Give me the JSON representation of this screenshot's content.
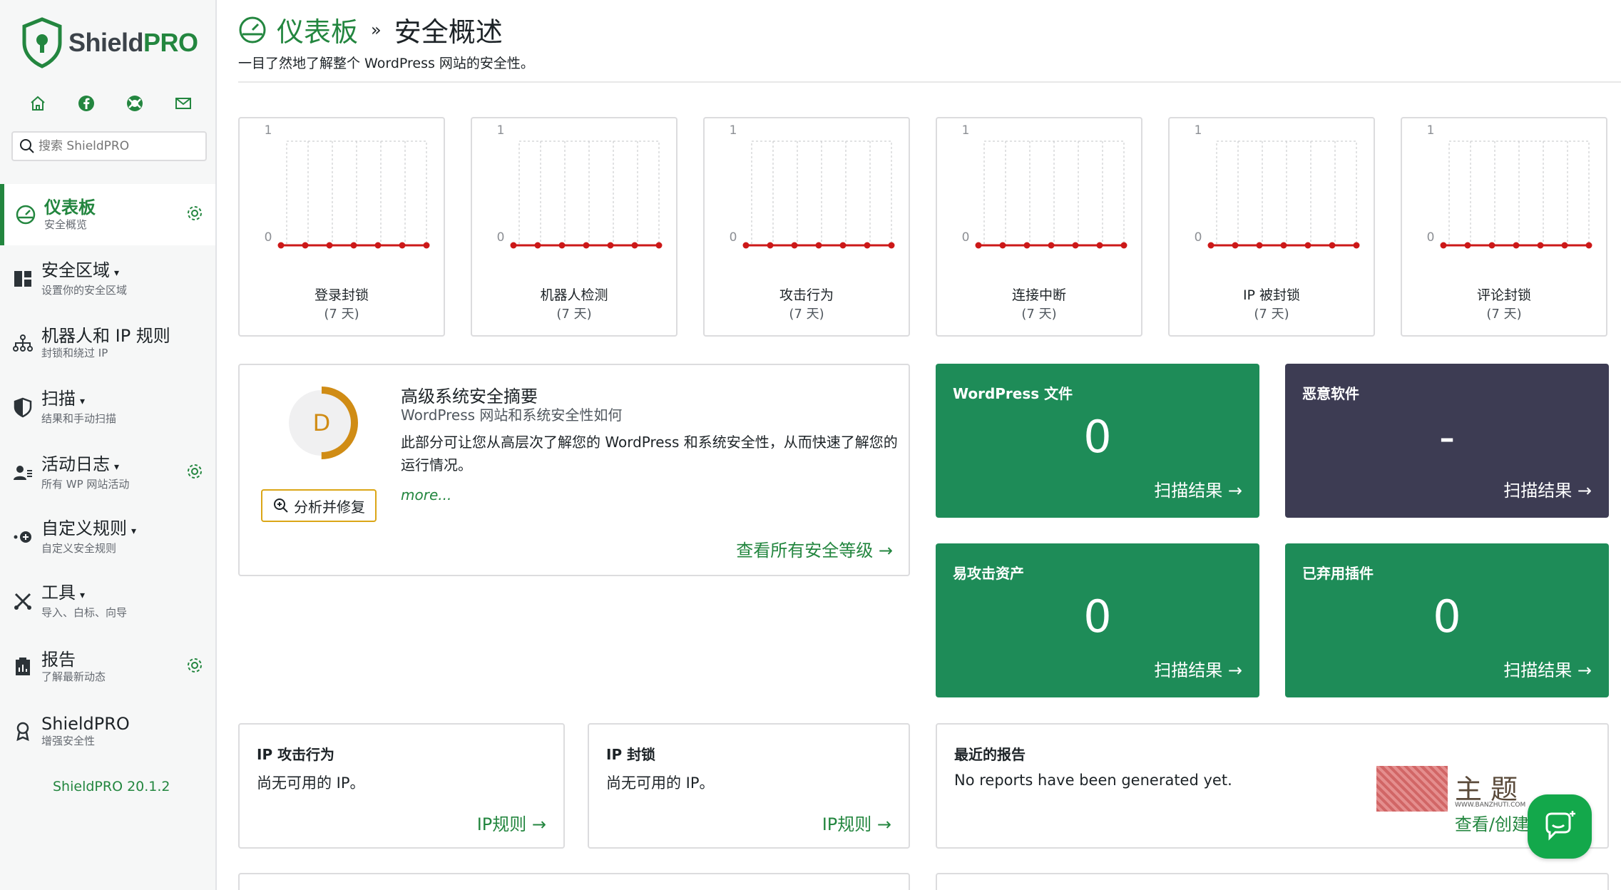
{
  "brand": {
    "name_main": "Shield",
    "name_pro": "PRO"
  },
  "search": {
    "placeholder": "搜索 ShieldPRO"
  },
  "quick_icons": [
    "home-icon",
    "facebook-icon",
    "support-icon",
    "mail-icon"
  ],
  "nav": [
    {
      "title": "仪表板",
      "sub": "安全概览",
      "icon": "dashboard-icon",
      "caret": "",
      "gear": true,
      "active": true
    },
    {
      "title": "安全区域",
      "sub": "设置你的安全区域",
      "icon": "layout-icon",
      "caret": "▾",
      "gear": false
    },
    {
      "title": "机器人和 IP 规则",
      "sub": "封锁和绕过 IP",
      "icon": "network-icon",
      "caret": "",
      "gear": false
    },
    {
      "title": "扫描",
      "sub": "结果和手动扫描",
      "icon": "shield-half-icon",
      "caret": "▾",
      "gear": false
    },
    {
      "title": "活动日志",
      "sub": "所有 WP 网站活动",
      "icon": "users-icon",
      "caret": "▾",
      "gear": true
    },
    {
      "title": "自定义规则",
      "sub": "自定义安全规则",
      "icon": "rules-icon",
      "caret": "▾",
      "gear": false
    },
    {
      "title": "工具",
      "sub": "导入、白标、向导",
      "icon": "tools-icon",
      "caret": "▾",
      "gear": false
    },
    {
      "title": "报告",
      "sub": "了解最新动态",
      "icon": "report-icon",
      "caret": "",
      "gear": true
    },
    {
      "title": "ShieldPRO",
      "sub": "增强安全性",
      "icon": "award-icon",
      "caret": "",
      "gear": false
    }
  ],
  "version": "ShieldPRO 20.1.2",
  "header": {
    "crumb1": "仪表板",
    "sep": "»",
    "crumb2": "安全概述",
    "subtitle": "一目了然地了解整个 WordPress 网站的安全性。"
  },
  "charts": [
    {
      "label": "登录封锁",
      "period": "(7 天)"
    },
    {
      "label": "机器人检测",
      "period": "(7 天)"
    },
    {
      "label": "攻击行为",
      "period": "(7 天)"
    },
    {
      "label": "连接中断",
      "period": "(7 天)"
    },
    {
      "label": "IP 被封锁",
      "period": "(7 天)"
    },
    {
      "label": "评论封锁",
      "period": "(7 天)"
    }
  ],
  "chart_data": {
    "type": "line",
    "note_series": "six sparkline charts, each with 7 daily points all at 0",
    "x": [
      1,
      2,
      3,
      4,
      5,
      6,
      7
    ],
    "ylim": [
      0,
      1
    ],
    "y_ticks": [
      "1",
      "0"
    ],
    "series": [
      {
        "name": "登录封锁",
        "values": [
          0,
          0,
          0,
          0,
          0,
          0,
          0
        ]
      },
      {
        "name": "机器人检测",
        "values": [
          0,
          0,
          0,
          0,
          0,
          0,
          0
        ]
      },
      {
        "name": "攻击行为",
        "values": [
          0,
          0,
          0,
          0,
          0,
          0,
          0
        ]
      },
      {
        "name": "连接中断",
        "values": [
          0,
          0,
          0,
          0,
          0,
          0,
          0
        ]
      },
      {
        "name": "IP 被封锁",
        "values": [
          0,
          0,
          0,
          0,
          0,
          0,
          0
        ]
      },
      {
        "name": "评论封锁",
        "values": [
          0,
          0,
          0,
          0,
          0,
          0,
          0
        ]
      }
    ],
    "line_color": "#cc1818",
    "grid": true
  },
  "summary": {
    "grade": "D",
    "grade_fraction": 0.5,
    "analyze": "分析并修复",
    "title": "高级系统安全摘要",
    "subtitle": "WordPress 网站和系统安全性如何",
    "desc": "此部分可让您从高层次了解您的 WordPress 和系统安全性，从而快速了解您的运行情况。",
    "more": "more...",
    "link": "查看所有安全等级 →"
  },
  "tiles": [
    {
      "title": "WordPress 文件",
      "value": "0",
      "link": "扫描结果 →"
    },
    {
      "title": "恶意软件",
      "value": "-",
      "link": "扫描结果 →"
    },
    {
      "title": "易攻击资产",
      "value": "0",
      "link": "扫描结果 →"
    },
    {
      "title": "已弃用插件",
      "value": "0",
      "link": "扫描结果 →"
    }
  ],
  "bottom": [
    {
      "title": "IP 攻击行为",
      "text": "尚无可用的 IP。",
      "link": "IP规则 →"
    },
    {
      "title": "IP 封锁",
      "text": "尚无可用的 IP。",
      "link": "IP规则 →"
    },
    {
      "title": "最近的报告",
      "text": "No reports have been generated yet.",
      "link": "查看/创建"
    }
  ],
  "watermark": {
    "text": "主题",
    "small": "WWW.BANZHUTI.COM"
  },
  "colors": {
    "accent": "#23863f",
    "tile_green": "#1e8c58",
    "tile_dark": "#3d3c53",
    "grade": "#d08c15"
  }
}
